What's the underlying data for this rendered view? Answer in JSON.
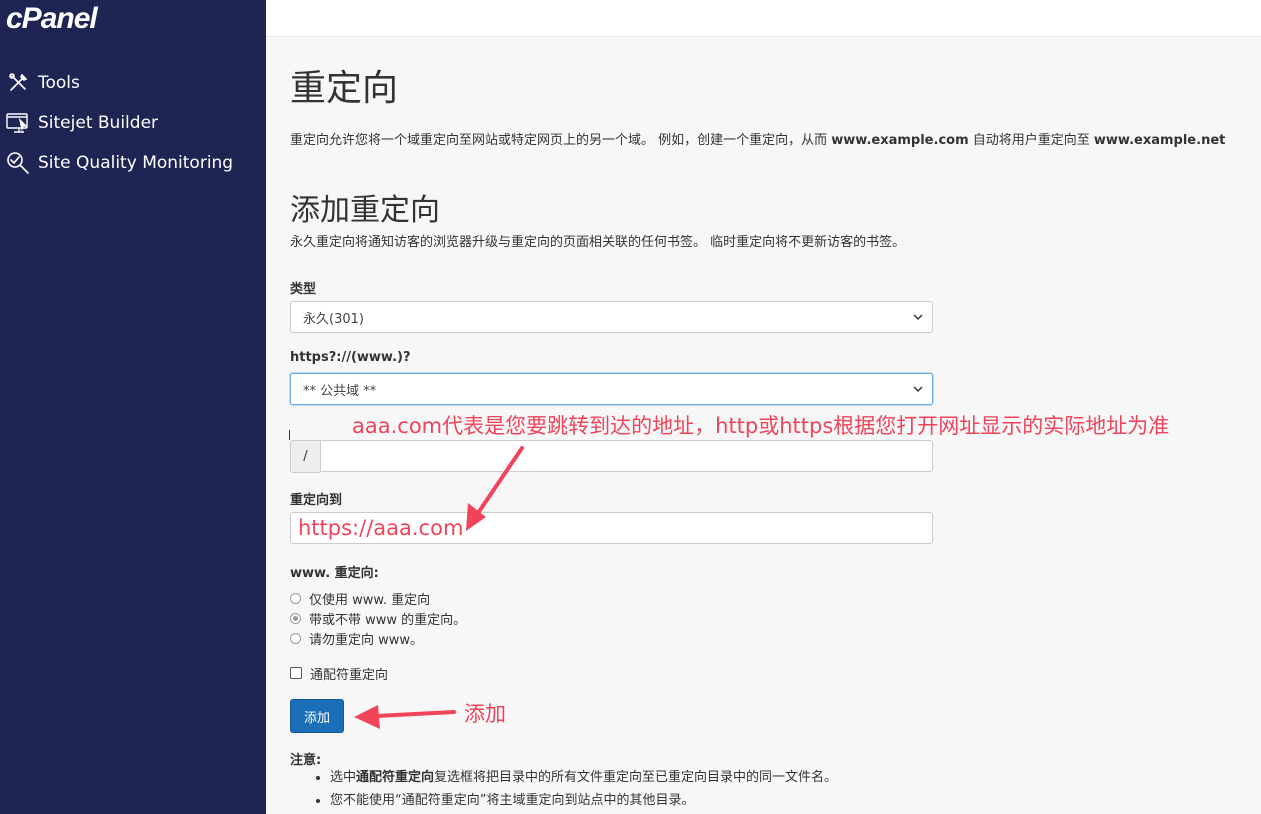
{
  "sidebar": {
    "logo": "cPanel",
    "items": [
      {
        "label": "Tools",
        "icon": "tools-icon"
      },
      {
        "label": "Sitejet Builder",
        "icon": "sitejet-icon"
      },
      {
        "label": "Site Quality Monitoring",
        "icon": "magnifier-icon"
      }
    ]
  },
  "page": {
    "title": "重定向",
    "description_pre": "重定向允许您将一个域重定向至网站或特定网页上的另一个域。 例如，创建一个重定向，从而 ",
    "description_domain1": "www.example.com",
    "description_mid": " 自动将用户重定向至 ",
    "description_domain2": "www.example.net",
    "add_section_title": "添加重定向",
    "add_section_desc": "永久重定向将通知访客的浏览器升级与重定向的页面相关联的任何书签。 临时重定向将不更新访客的书签。"
  },
  "form": {
    "type_label": "类型",
    "type_value": "永久(301)",
    "domain_label": "https?://(www.)?",
    "domain_value": "** 公共域 **",
    "path_prefix": "/",
    "path_value": "",
    "redirect_to_label": "重定向到",
    "redirect_to_value": "https://aaa.com",
    "www_label": "www. 重定向:",
    "www_options": [
      {
        "label": "仅使用 www. 重定向",
        "checked": false
      },
      {
        "label": "带或不带 www 的重定向。",
        "checked": true
      },
      {
        "label": "请勿重定向 www。",
        "checked": false
      }
    ],
    "wildcard_label": "通配符重定向",
    "wildcard_checked": false,
    "add_button": "添加"
  },
  "notes": {
    "title": "注意:",
    "item1_pre": "选中",
    "item1_bold": "通配符重定向",
    "item1_post": "复选框将把目录中的所有文件重定向至已重定向目录中的同一文件名。",
    "item2": "您不能使用“通配符重定向”将主域重定向到站点中的其他目录。"
  },
  "annotations": {
    "domain_note": "aaa.com代表是您要跳转到达的地址，http或https根据您打开网址显示的实际地址为准",
    "add_note": "添加",
    "color": "#f0445b"
  },
  "colors": {
    "sidebar_bg": "#1e2553",
    "button_bg": "#1b6eb8"
  }
}
